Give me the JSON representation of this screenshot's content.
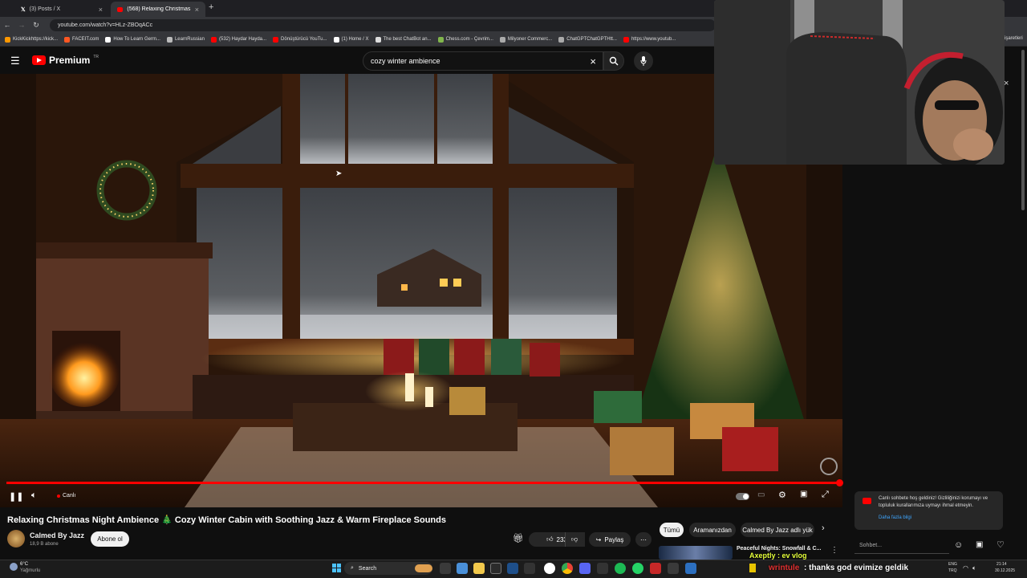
{
  "browser": {
    "tabs": [
      {
        "label": "(3) Posts / X",
        "active": false
      },
      {
        "label": "(568) Relaxing Christmas N",
        "active": true
      }
    ],
    "url": "youtube.com/watch?v=HLz-ZBOqACc",
    "bookmarks": [
      "KickKickhttps://kick...",
      "FACEIT.com",
      "How To Learn Germ...",
      "LearnRussian",
      "(532) Haydar Hayda...",
      "Dönüştürücü YouTu...",
      "(1) Home / X",
      "The best ChatBot an...",
      "Chess.com - Çevrim...",
      "Milyoner Commerc...",
      "ChatGPTChatGPTHtt...",
      "https://www.youtub..."
    ],
    "bookmark_colors": [
      "#ff9800",
      "#ff5722",
      "#ffffff",
      "#bbbbbb",
      "#ff0000",
      "#ff0000",
      "#ffffff",
      "#dddddd",
      "#81b64c",
      "#aaaaaa",
      "#aaaaaa",
      "#ff0000"
    ],
    "bookmarks_right": "işaretleri"
  },
  "youtube": {
    "logo_text": "Premium",
    "logo_region": "TR",
    "search_value": "cozy winter ambience",
    "icons": {
      "menu": "hamburger-icon",
      "clear": "close-icon",
      "search": "search-icon",
      "mic": "mic-icon"
    }
  },
  "player": {
    "live_label": "Canlı",
    "progress_percent": 99,
    "accent_color": "#ff0000"
  },
  "video": {
    "title": "Relaxing Christmas Night Ambience 🎄 Cozy Winter Cabin with Soothing Jazz & Warm Fireplace Sounds",
    "channel_name": "Calmed By Jazz",
    "subscribers": "18,9 B abone",
    "subscribe_label": "Abone ol",
    "likes": "233",
    "share_label": "Paylaş"
  },
  "recommendation_chips": [
    "Tümü",
    "Aramanızdan",
    "Calmed By Jazz adlı yük"
  ],
  "next_video": {
    "title": "Peaceful Nights: Snowfall & C...",
    "overlay_text": "Axeptly : ev vlog"
  },
  "chat": {
    "notice": "Canlı sohbete hoş geldiniz! Gizliliğinizi korumayı ve topluluk kurallarımıza uymayı ihmal etmeyin.",
    "learn_more": "Daha fazla bilgi",
    "input_placeholder": "Sohbet..."
  },
  "taskbar": {
    "weather_temp": "6°C",
    "weather_place": "Yağmurlu",
    "search_label": "Search",
    "stream_chat_user": "wrintule",
    "stream_chat_message": ": thanks god evimize geldik",
    "lang_top": "ENG",
    "lang_bottom": "TRQ",
    "time": "21:14",
    "date": "30.12.2025"
  }
}
